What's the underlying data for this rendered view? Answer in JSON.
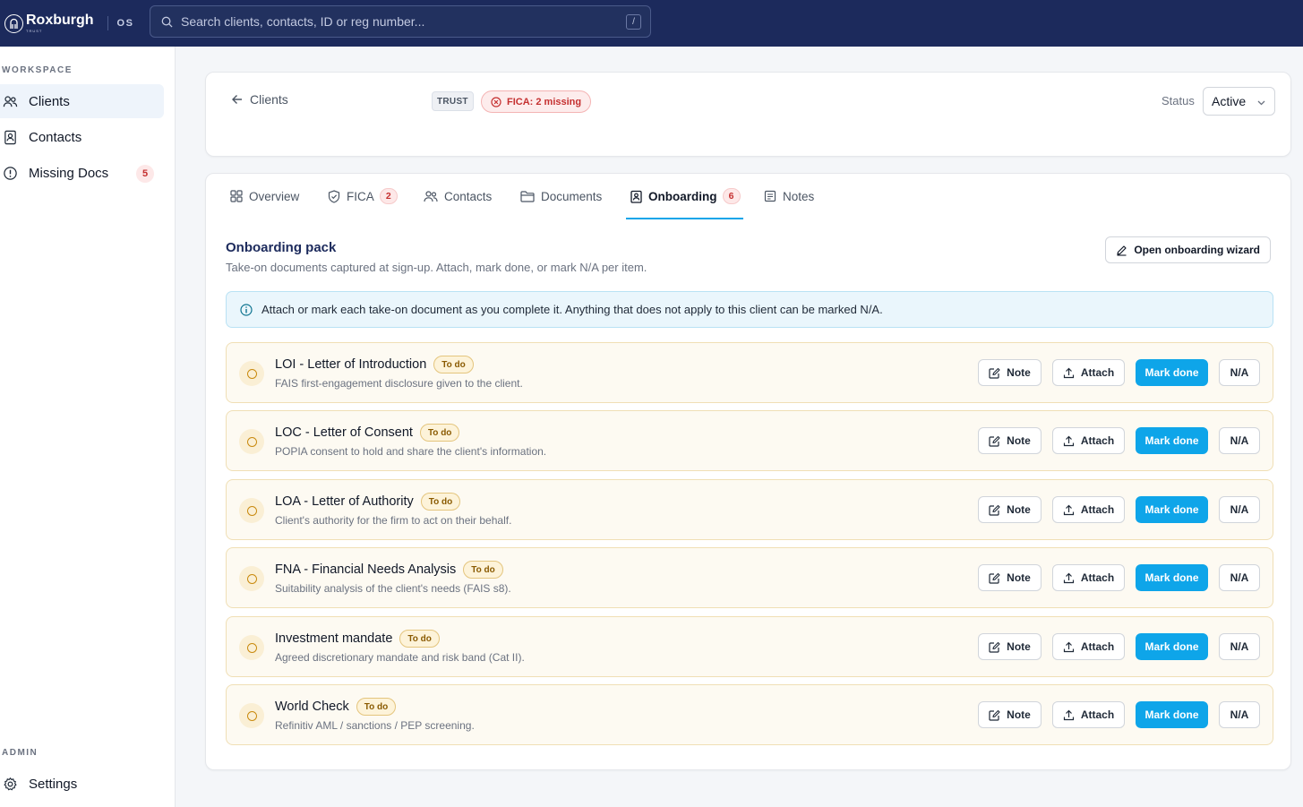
{
  "app": {
    "brand": "Roxburgh",
    "brand_sub": "TRUST",
    "product": "OS",
    "search_placeholder": "Search clients, contacts, ID or reg number...",
    "search_shortcut": "/"
  },
  "sidebar": {
    "workspace_label": "WORKSPACE",
    "items": [
      {
        "label": "Clients",
        "icon": "users-icon",
        "active": true
      },
      {
        "label": "Contacts",
        "icon": "contact-book-icon"
      },
      {
        "label": "Missing Docs",
        "icon": "alert-circle-icon",
        "badge": "5"
      }
    ],
    "admin_label": "ADMIN",
    "admin_items": [
      {
        "label": "Settings",
        "icon": "gear-icon"
      }
    ]
  },
  "header": {
    "back_label": "Clients",
    "type_badge": "TRUST",
    "fica_badge": "FICA: 2 missing",
    "status_label": "Status",
    "status_value": "Active"
  },
  "tabs": [
    {
      "label": "Overview",
      "icon": "grid-icon"
    },
    {
      "label": "FICA",
      "icon": "shield-check-icon",
      "count": "2"
    },
    {
      "label": "Contacts",
      "icon": "users-icon"
    },
    {
      "label": "Documents",
      "icon": "folder-icon"
    },
    {
      "label": "Onboarding",
      "icon": "clipboard-icon",
      "count": "6",
      "active": true
    },
    {
      "label": "Notes",
      "icon": "note-icon"
    }
  ],
  "onboarding": {
    "title": "Onboarding pack",
    "subtitle": "Take-on documents captured at sign-up. Attach, mark done, or mark N/A per item.",
    "wizard_button": "Open onboarding wizard",
    "info": "Attach or mark each take-on document as you complete it. Anything that does not apply to this client can be marked N/A.",
    "status_badge": "To do",
    "actions": {
      "note": "Note",
      "attach": "Attach",
      "done": "Mark done",
      "na": "N/A"
    },
    "items": [
      {
        "name": "LOI - Letter of Introduction",
        "desc": "FAIS first-engagement disclosure given to the client.",
        "status": "To do"
      },
      {
        "name": "LOC - Letter of Consent",
        "desc": "POPIA consent to hold and share the client's information.",
        "status": "To do"
      },
      {
        "name": "LOA - Letter of Authority",
        "desc": "Client's authority for the firm to act on their behalf.",
        "status": "To do"
      },
      {
        "name": "FNA - Financial Needs Analysis",
        "desc": "Suitability analysis of the client's needs (FAIS s8).",
        "status": "To do"
      },
      {
        "name": "Investment mandate",
        "desc": "Agreed discretionary mandate and risk band (Cat II).",
        "status": "To do"
      },
      {
        "name": "World Check",
        "desc": "Refinitiv AML / sanctions / PEP screening.",
        "status": "To do"
      }
    ]
  },
  "colors": {
    "topbar": "#1c2a5c",
    "accent": "#0ea5e9",
    "danger": "#c53030",
    "todo": "#8a5a00"
  }
}
